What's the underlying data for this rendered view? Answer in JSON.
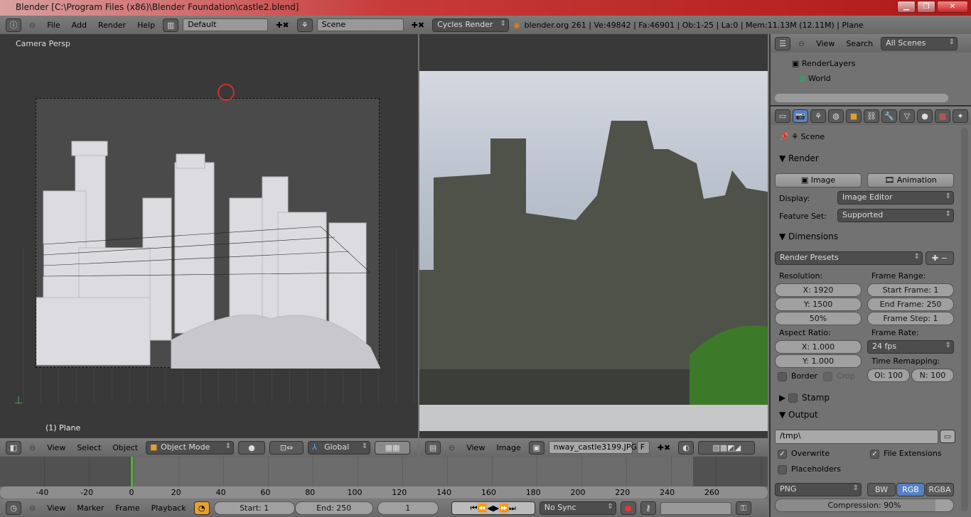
{
  "window": {
    "title": "Blender [C:\\Program Files (x86)\\Blender Foundation\\castle2.blend]"
  },
  "topbar": {
    "menus": [
      "File",
      "Add",
      "Render",
      "Help"
    ],
    "screen_layout": "Default",
    "scene": "Scene",
    "engine": "Cycles Render",
    "stats": "blender.org 261 | Ve:49842 | Fa:46901 | Ob:1-25 | La:0 | Mem:11.13M (12.11M) | Plane"
  },
  "viewport3d": {
    "label": "Camera Persp",
    "object_label": "(1) Plane",
    "menus": [
      "View",
      "Select",
      "Object"
    ],
    "mode": "Object Mode",
    "orientation": "Global"
  },
  "image_editor": {
    "menus": [
      "View",
      "Image"
    ],
    "image_name": "nway_castle3199.JPG",
    "fake_user": "F"
  },
  "timeline": {
    "ticks": [
      -40,
      -20,
      0,
      20,
      40,
      60,
      80,
      100,
      120,
      140,
      160,
      180,
      200,
      220,
      240,
      260
    ],
    "current_frame": 1,
    "menus": [
      "View",
      "Marker",
      "Frame",
      "Playback"
    ],
    "start": "Start: 1",
    "end": "End: 250",
    "frame": "1",
    "sync": "No Sync",
    "accent": "#4fb030"
  },
  "outliner": {
    "menus": [
      "View",
      "Search"
    ],
    "filter": "All Scenes",
    "items": [
      "RenderLayers",
      "World"
    ]
  },
  "properties": {
    "context": "Scene",
    "render": {
      "title": "Render",
      "image_btn": "Image",
      "animation_btn": "Animation",
      "display_label": "Display:",
      "display": "Image Editor",
      "feature_label": "Feature Set:",
      "feature": "Supported"
    },
    "dimensions": {
      "title": "Dimensions",
      "presets": "Render Presets",
      "resolution_label": "Resolution:",
      "res_x": "X: 1920",
      "res_y": "Y: 1500",
      "res_pct": "50%",
      "frame_range_label": "Frame Range:",
      "start_frame": "Start Frame: 1",
      "end_frame": "End Frame: 250",
      "frame_step": "Frame Step: 1",
      "aspect_label": "Aspect Ratio:",
      "aspect_x": "X: 1.000",
      "aspect_y": "Y: 1.000",
      "frame_rate_label": "Frame Rate:",
      "fps": "24 fps",
      "time_remap_label": "Time Remapping:",
      "old": "Ol: 100",
      "new": "N: 100",
      "border": "Border",
      "crop": "Crop"
    },
    "stamp": {
      "title": "Stamp"
    },
    "output": {
      "title": "Output",
      "path": "/tmp\\",
      "overwrite": "Overwrite",
      "file_extensions": "File Extensions",
      "placeholders": "Placeholders",
      "format": "PNG",
      "bw": "BW",
      "rgb": "RGB",
      "rgba": "RGBA",
      "compression": "Compression: 90%",
      "compression_value": 90,
      "selected_color_mode": "RGB",
      "accent": "#5680c2"
    }
  }
}
